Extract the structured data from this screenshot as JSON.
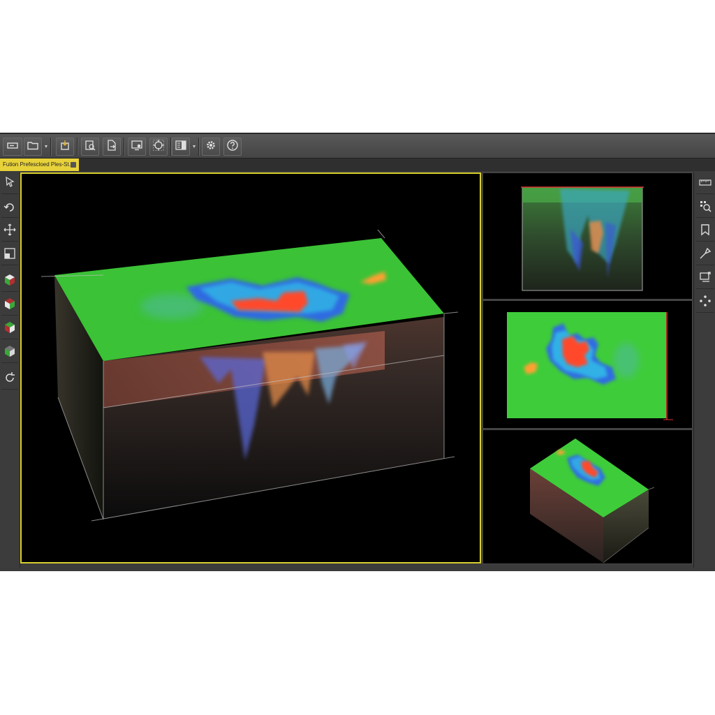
{
  "document_tab": {
    "title": "Fution Prefescloed Ples-St..."
  },
  "toolbar": {
    "buttons": [
      {
        "icon": "layout-toggle-icon"
      },
      {
        "icon": "open-folder-icon"
      },
      {
        "icon": "import-icon"
      },
      {
        "icon": "inspect-document-icon"
      },
      {
        "icon": "export-document-icon"
      },
      {
        "icon": "screen-capture-icon"
      },
      {
        "icon": "target-crosshair-icon"
      },
      {
        "icon": "panel-layout-icon"
      },
      {
        "icon": "settings-gear-icon"
      },
      {
        "icon": "help-icon"
      }
    ]
  },
  "left_tools": [
    {
      "icon": "select-pointer-icon"
    },
    {
      "icon": "rotate-view-icon"
    },
    {
      "icon": "pan-move-icon"
    },
    {
      "icon": "zoom-box-icon"
    },
    {
      "icon": "view-cube-top-icon"
    },
    {
      "icon": "view-cube-front-icon"
    },
    {
      "icon": "view-cube-side-icon"
    },
    {
      "icon": "view-cube-iso-icon"
    },
    {
      "icon": "reset-view-icon"
    }
  ],
  "right_tools": [
    {
      "icon": "ruler-icon"
    },
    {
      "icon": "zoom-grid-icon"
    },
    {
      "icon": "bookmark-icon"
    },
    {
      "icon": "probe-pick-icon"
    },
    {
      "icon": "screen-export-icon"
    },
    {
      "icon": "navigate-dpad-icon"
    }
  ],
  "colors": {
    "active_viewport_border": "#d9cf2e",
    "surface_green": "#3fcc3a",
    "anomaly_high": "#ff4a2a",
    "anomaly_mid": "#ffa030",
    "anomaly_low": "#2d5cff",
    "anomaly_cyan": "#33c3e6",
    "soil_brown": "#6b4038"
  }
}
